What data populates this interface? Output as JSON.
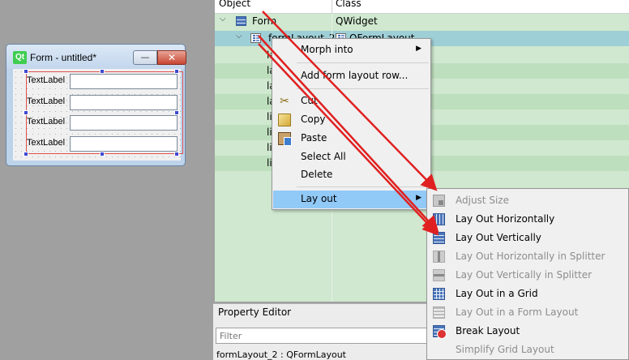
{
  "form_window": {
    "title": "Form - untitled*",
    "logo_text": "Qt",
    "minimize_glyph": "—",
    "close_glyph": "✕",
    "rows": [
      {
        "label": "TextLabel"
      },
      {
        "label": "TextLabel"
      },
      {
        "label": "TextLabel"
      },
      {
        "label": "TextLabel"
      }
    ]
  },
  "object_inspector": {
    "header_object": "Object",
    "header_class": "Class",
    "rows": [
      {
        "object": "Form",
        "class": "QWidget"
      },
      {
        "object": "formLayout_2",
        "class": "QFormLayout"
      },
      {
        "object": "la"
      },
      {
        "object": "la"
      },
      {
        "object": "la"
      },
      {
        "object": "la"
      },
      {
        "object": "li"
      },
      {
        "object": "li"
      },
      {
        "object": "li"
      },
      {
        "object": "li"
      }
    ]
  },
  "context_menu": {
    "items": {
      "morph": "Morph into",
      "add_row": "Add form layout row...",
      "cut": "Cut",
      "copy": "Copy",
      "paste": "Paste",
      "select_all": "Select All",
      "delete": "Delete",
      "layout": "Lay out"
    },
    "submenu_arrow": "▶"
  },
  "layout_submenu": {
    "items": [
      {
        "label": "Adjust Size",
        "enabled": false,
        "icon": "adjust-size-icon"
      },
      {
        "label": "Lay Out Horizontally",
        "enabled": true,
        "icon": "horizontal-layout-icon"
      },
      {
        "label": "Lay Out Vertically",
        "enabled": true,
        "icon": "vertical-layout-icon"
      },
      {
        "label": "Lay Out Horizontally in Splitter",
        "enabled": false,
        "icon": "horizontal-splitter-icon"
      },
      {
        "label": "Lay Out Vertically in Splitter",
        "enabled": false,
        "icon": "vertical-splitter-icon"
      },
      {
        "label": "Lay Out in a Grid",
        "enabled": true,
        "icon": "grid-layout-icon"
      },
      {
        "label": "Lay Out in a Form Layout",
        "enabled": false,
        "icon": "form-layout-icon"
      },
      {
        "label": "Break Layout",
        "enabled": true,
        "icon": "break-layout-icon"
      },
      {
        "label": "Simplify Grid Layout",
        "enabled": false,
        "icon": "simplify-grid-icon"
      }
    ]
  },
  "property_editor": {
    "title": "Property Editor",
    "filter_placeholder": "Filter",
    "status": "formLayout_2 : QFormLayout"
  },
  "colors": {
    "tree_background": "#cfe8cf",
    "menu_highlight": "#91c9f7",
    "annotation_arrow": "#e02020"
  }
}
